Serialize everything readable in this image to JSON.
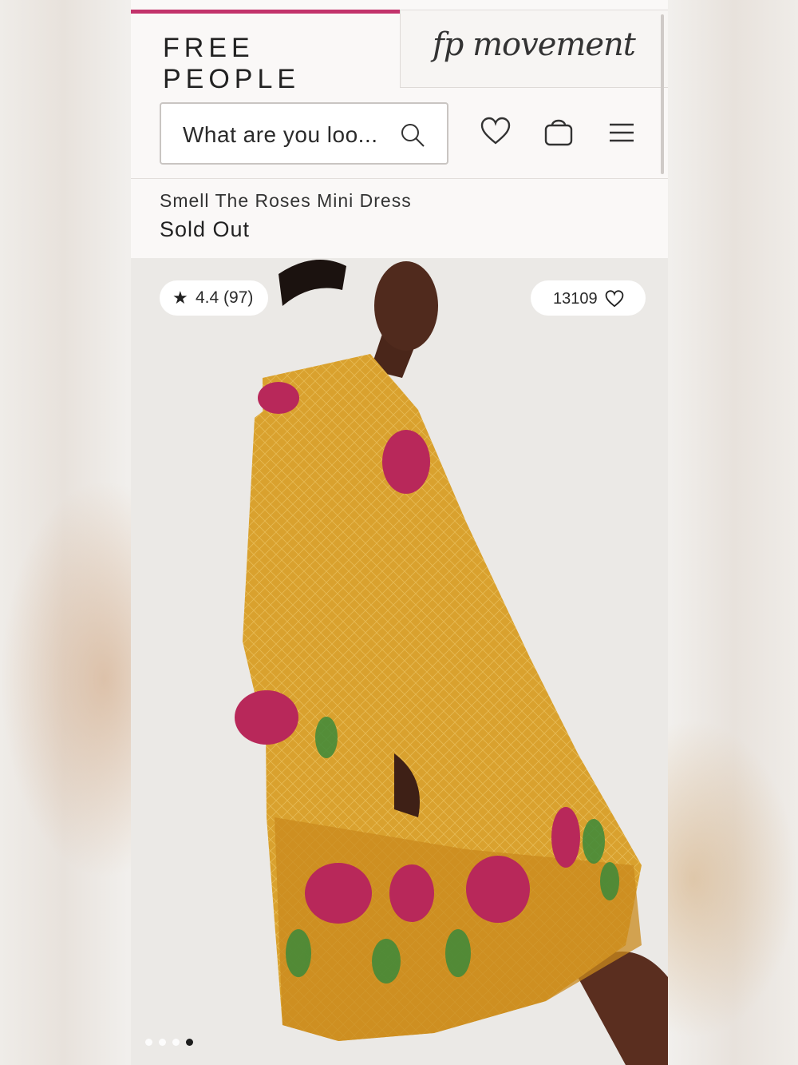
{
  "brand": {
    "primary_logo": "FREE PEOPLE",
    "secondary_logo": "fp movement",
    "accent_color": "#c2336b"
  },
  "header": {
    "search_placeholder": "What are you loo...",
    "icons": [
      "search-icon",
      "heart-icon",
      "bag-icon",
      "menu-icon"
    ]
  },
  "product": {
    "name": "Smell The Roses Mini Dress",
    "status": "Sold Out"
  },
  "hero": {
    "rating": "4.4 (97)",
    "favorites_count": "13109",
    "carousel": {
      "total": 4,
      "active_index": 4
    }
  }
}
